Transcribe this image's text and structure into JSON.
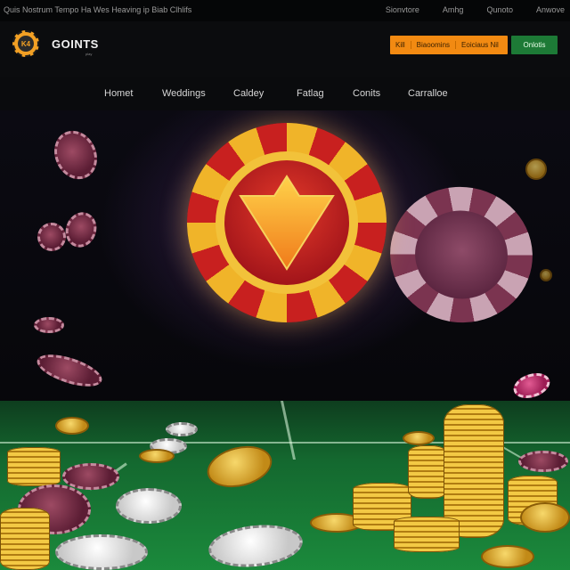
{
  "topbar": {
    "tagline": "Quis Nostrum Tempo Ha Wes Heaving ip Biab Clhlifs",
    "links": [
      "Sionvtore",
      "Amhg",
      "Qunoto",
      "Anwove"
    ]
  },
  "header": {
    "logo_text": "K4",
    "brand": "GOINTS",
    "brand_sub": "play",
    "promo": [
      "Kill",
      "Biaoomins",
      "Eoiciaus Nil"
    ],
    "cta": "Onlotis"
  },
  "nav": {
    "items": [
      "Homet",
      "Weddings",
      "Caldey",
      "Fatlag",
      "Conits",
      "Carralloe"
    ]
  },
  "colors": {
    "accent_orange": "#f28a12",
    "accent_green": "#1d7a36",
    "chip_red": "#c8201f",
    "chip_gold": "#f0b429",
    "table_green": "#1b8a3c"
  }
}
